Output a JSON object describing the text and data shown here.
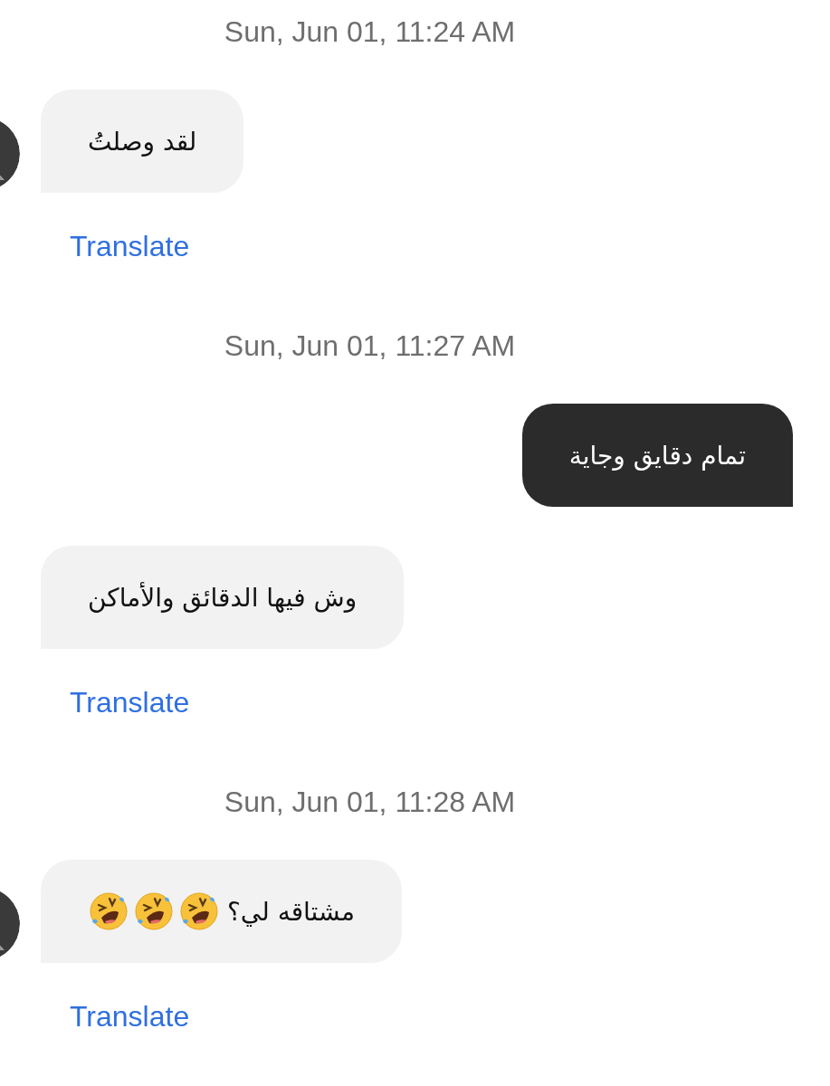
{
  "messages": [
    {
      "kind": "timestamp",
      "text": "Sun, Jun 01, 11:24 AM"
    },
    {
      "kind": "incoming",
      "avatar": true,
      "text": "لقد وصلتُ",
      "translate": "Translate"
    },
    {
      "kind": "timestamp",
      "text": "Sun, Jun 01, 11:27 AM"
    },
    {
      "kind": "outgoing",
      "text": "تمام دقايق وجاية"
    },
    {
      "kind": "incoming",
      "avatar": false,
      "text": "وش فيها الدقائق والأماكن",
      "translate": "Translate"
    },
    {
      "kind": "timestamp",
      "text": "Sun, Jun 01, 11:28 AM"
    },
    {
      "kind": "incoming",
      "avatar": true,
      "text": "مشتاقه لي؟",
      "emojis": [
        {
          "kind": "rolling-laughing"
        },
        {
          "kind": "rolling-laughing"
        },
        {
          "kind": "rolling-laughing"
        }
      ],
      "translate": "Translate"
    }
  ]
}
